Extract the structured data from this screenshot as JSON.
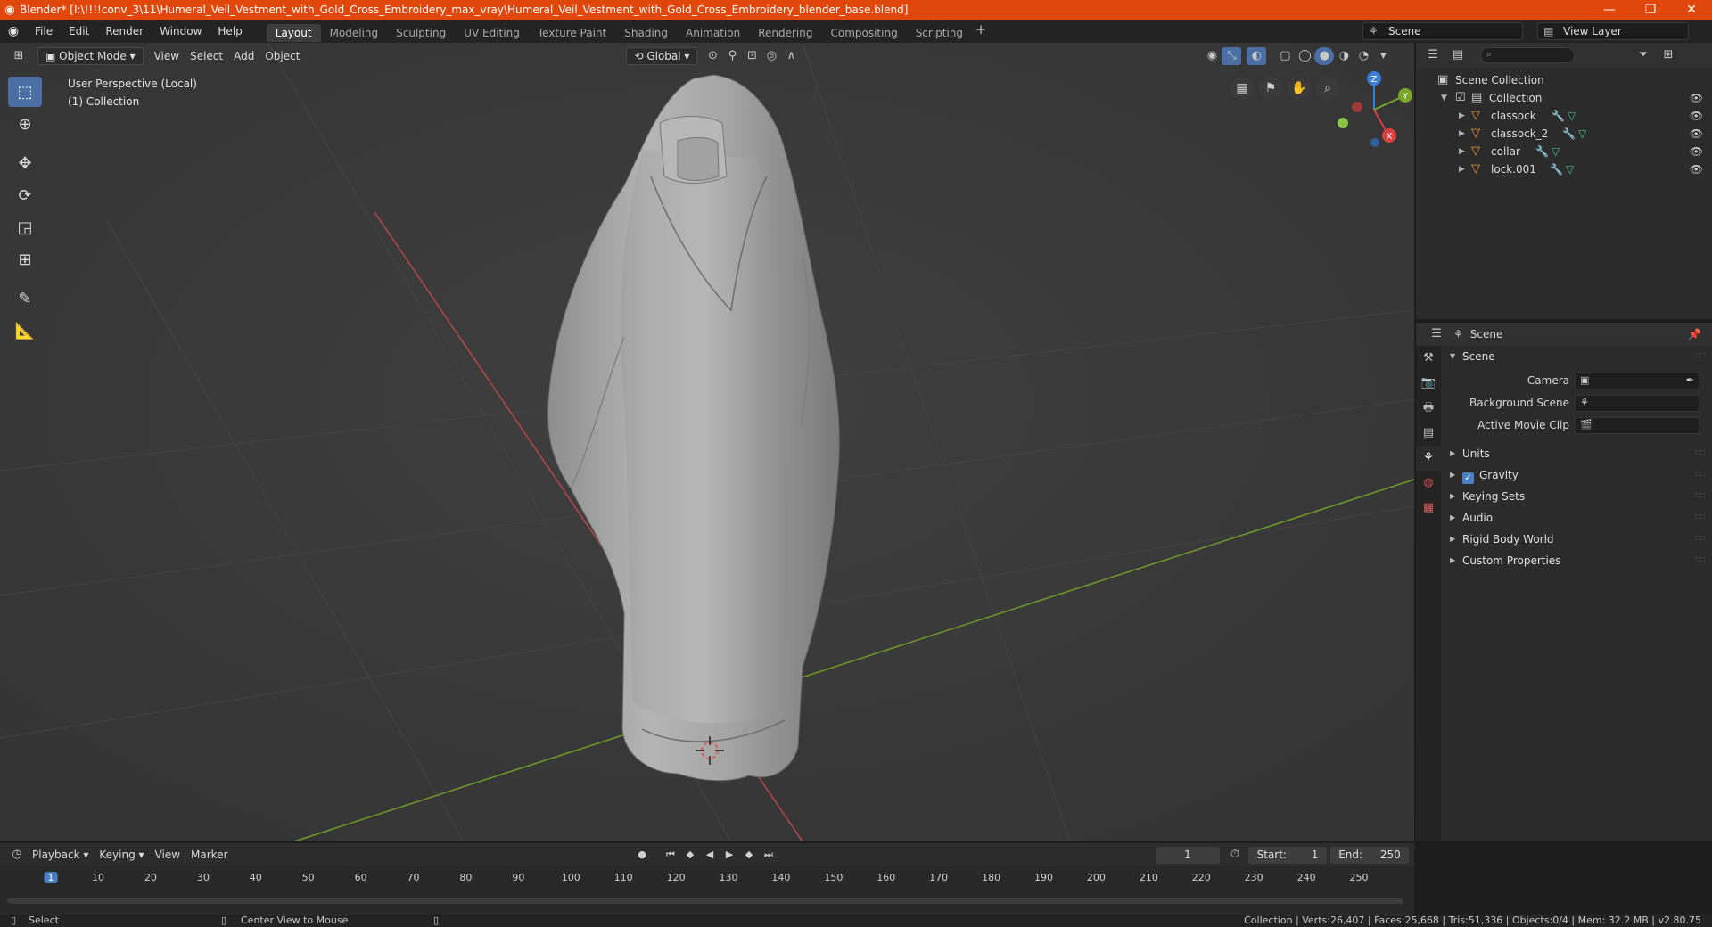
{
  "titlebar": {
    "title": "Blender* [I:\\!!!!conv_3\\11\\Humeral_Veil_Vestment_with_Gold_Cross_Embroidery_max_vray\\Humeral_Veil_Vestment_with_Gold_Cross_Embroidery_blender_base.blend]"
  },
  "menu": {
    "items": [
      "File",
      "Edit",
      "Render",
      "Window",
      "Help"
    ]
  },
  "workspaces": [
    "Layout",
    "Modeling",
    "Sculpting",
    "UV Editing",
    "Texture Paint",
    "Shading",
    "Animation",
    "Rendering",
    "Compositing",
    "Scripting"
  ],
  "scene": {
    "name": "Scene",
    "view_layer": "View Layer"
  },
  "viewport": {
    "mode": "Object Mode",
    "menus": [
      "View",
      "Select",
      "Add",
      "Object"
    ],
    "orientation": "Global",
    "info_line1": "User Perspective (Local)",
    "info_line2": "(1) Collection",
    "gizmo": {
      "z": "Z",
      "y": "Y",
      "x": "X"
    }
  },
  "outliner": {
    "root": "Scene Collection",
    "collection": "Collection",
    "objects": [
      "classock",
      "classock_2",
      "collar",
      "lock.001"
    ]
  },
  "properties": {
    "header": "Scene",
    "panel": "Scene",
    "camera_label": "Camera",
    "bg_scene_label": "Background Scene",
    "movie_clip_label": "Active Movie Clip",
    "sections": [
      "Units",
      "Gravity",
      "Keying Sets",
      "Audio",
      "Rigid Body World",
      "Custom Properties"
    ]
  },
  "timeline": {
    "menus": [
      "Playback",
      "Keying",
      "View",
      "Marker"
    ],
    "current_frame": "1",
    "start_label": "Start:",
    "start": "1",
    "end_label": "End:",
    "end": "250",
    "ticks": [
      "1",
      "10",
      "20",
      "30",
      "40",
      "50",
      "60",
      "70",
      "80",
      "90",
      "100",
      "110",
      "120",
      "130",
      "140",
      "150",
      "160",
      "170",
      "180",
      "190",
      "200",
      "210",
      "220",
      "230",
      "240",
      "250"
    ]
  },
  "status": {
    "left": "Select",
    "middle": "Center View to Mouse",
    "stats": "Collection | Verts:26,407 | Faces:25,668 | Tris:51,336 | Objects:0/4 | Mem: 32.2 MB | v2.80.75"
  }
}
